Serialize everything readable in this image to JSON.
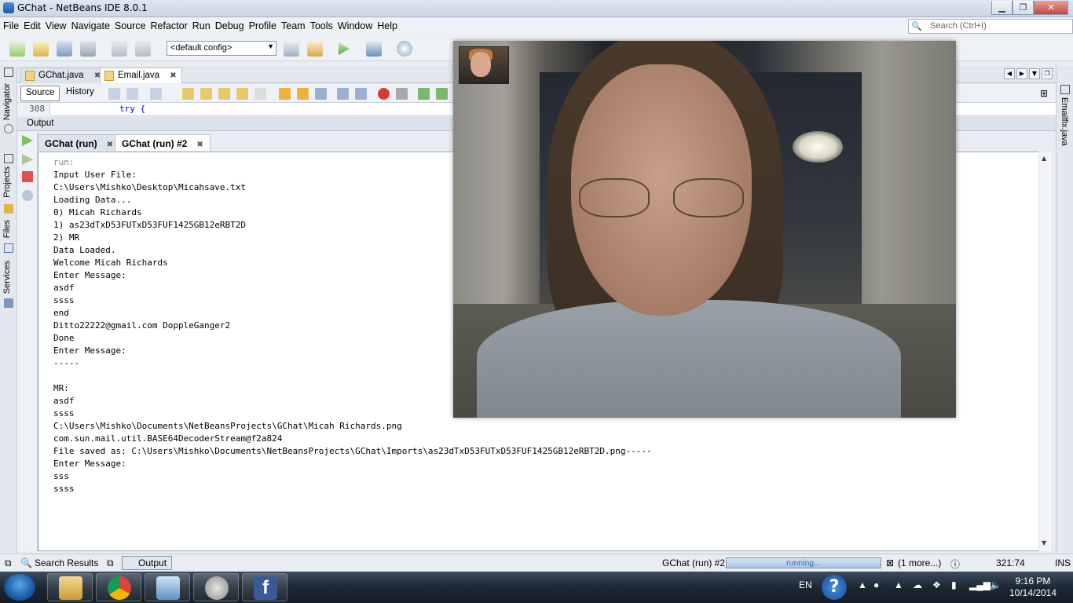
{
  "window": {
    "title": "GChat - NetBeans IDE 8.0.1",
    "controls": {
      "minimize": "▁",
      "maximize": "❐",
      "close": "✕"
    }
  },
  "menu": [
    "File",
    "Edit",
    "View",
    "Navigate",
    "Source",
    "Refactor",
    "Run",
    "Debug",
    "Profile",
    "Team",
    "Tools",
    "Window",
    "Help"
  ],
  "search": {
    "placeholder": "Search (Ctrl+I)"
  },
  "toolbar": {
    "config": "<default config>"
  },
  "left_sidebar": {
    "navigator": "Navigator",
    "projects": "Projects",
    "files": "Files",
    "services": "Services"
  },
  "right_sidebar": {
    "tab": "Emailfix.java"
  },
  "editor": {
    "tabs": [
      {
        "label": "GChat.java"
      },
      {
        "label": "Email.java"
      }
    ],
    "source_btn": "Source",
    "history_btn": "History",
    "line_number": "308",
    "line_code": "try {"
  },
  "output": {
    "header": "Output",
    "tabs": [
      {
        "label": "GChat (run)"
      },
      {
        "label": "GChat (run) #2"
      }
    ],
    "lines": [
      "run:",
      "Input User File:",
      "C:\\Users\\Mishko\\Desktop\\Micahsave.txt",
      "Loading Data...",
      "0) Micah Richards",
      "1) as23dTxD53FUTxD53FUF1425GB12eRBT2D",
      "2) MR",
      "Data Loaded.",
      "Welcome Micah Richards",
      "Enter Message:",
      "asdf",
      "ssss",
      "end",
      "Ditto22222@gmail.com DoppleGanger2",
      "Done",
      "Enter Message:",
      "-----",
      "",
      "MR:",
      "asdf",
      "ssss",
      "C:\\Users\\Mishko\\Documents\\NetBeansProjects\\GChat\\Micah Richards.png",
      "com.sun.mail.util.BASE64DecoderStream@f2a824",
      "File saved as: C:\\Users\\Mishko\\Documents\\NetBeansProjects\\GChat\\Imports\\as23dTxD53FUTxD53FUF1425GB12eRBT2D.png-----",
      "Enter Message:",
      "sss",
      "ssss"
    ]
  },
  "status": {
    "search_results": "Search Results",
    "output_btn": "Output",
    "task": "GChat (run) #2",
    "progress_label": "running...",
    "more": "(1 more...)",
    "position": "321:74",
    "mode": "INS"
  },
  "taskbar": {
    "lang": "EN",
    "time": "9:16 PM",
    "date": "10/14/2014",
    "help": "?"
  }
}
